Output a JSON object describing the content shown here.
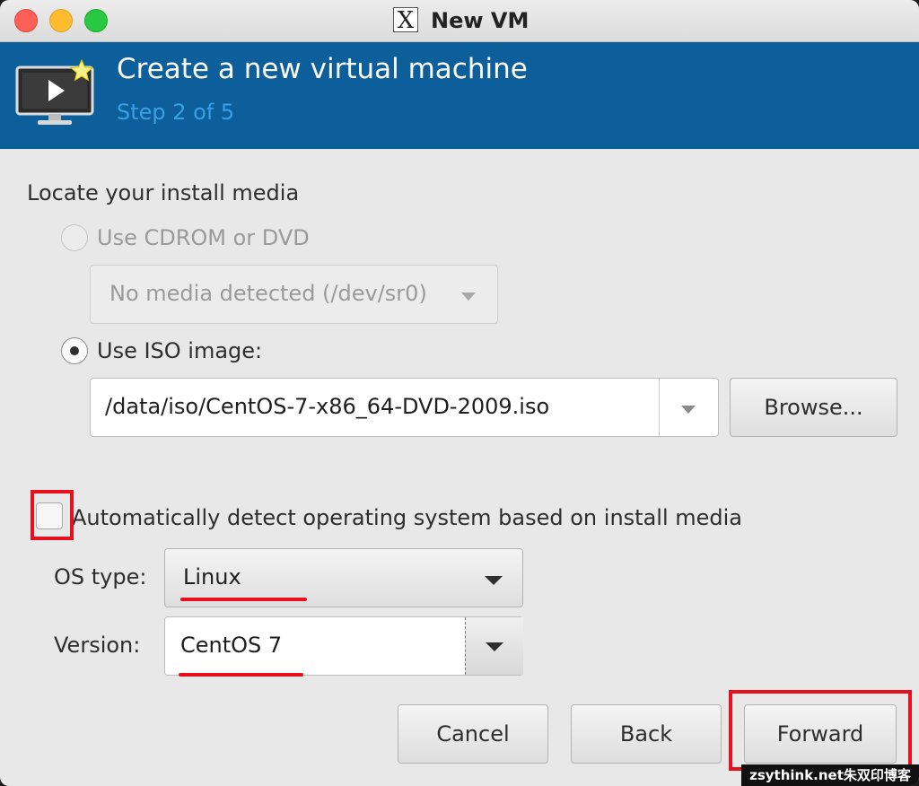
{
  "window": {
    "title": "New VM"
  },
  "banner": {
    "title": "Create a new virtual machine",
    "step": "Step 2 of 5"
  },
  "media": {
    "heading": "Locate your install media",
    "cdrom_label": "Use CDROM or DVD",
    "cdrom_value": "No media detected (/dev/sr0)",
    "iso_label": "Use ISO image:",
    "iso_path": "/data/iso/CentOS-7-x86_64-DVD-2009.iso",
    "browse_label": "Browse...",
    "selected": "iso"
  },
  "os": {
    "auto_detect_label": "Automatically detect operating system based on install media",
    "auto_detect_checked": false,
    "type_label": "OS type:",
    "type_value": "Linux",
    "version_label": "Version:",
    "version_value": "CentOS 7"
  },
  "footer": {
    "cancel_label": "Cancel",
    "back_label": "Back",
    "forward_label": "Forward"
  },
  "watermark": {
    "text": "zsythink.net朱双印博客"
  },
  "colors": {
    "banner": "#0c5f9a",
    "step_text": "#3aa0e4",
    "annotation": "#e8101c"
  },
  "icons": {
    "app": "x11-icon",
    "banner": "vm-monitor-new-icon"
  }
}
